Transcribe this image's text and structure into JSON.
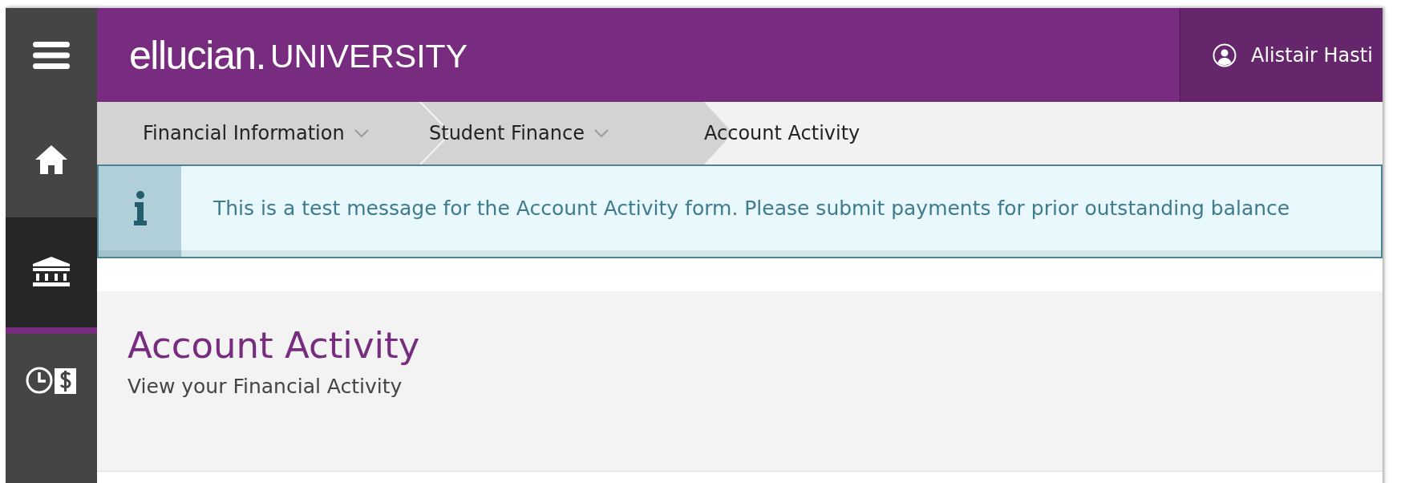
{
  "sidebar": {
    "items": [
      {
        "kind": "menu",
        "selected": false
      },
      {
        "kind": "home",
        "selected": false
      },
      {
        "kind": "bank",
        "selected": true
      },
      {
        "kind": "clock-dollar",
        "selected": false
      }
    ]
  },
  "header": {
    "logo_brand": "ellucian.",
    "logo_text": "UNIVERSITY",
    "user_name": "Alistair Hasti"
  },
  "breadcrumbs": [
    {
      "label": "Financial Information",
      "dropdown": true
    },
    {
      "label": "Student Finance",
      "dropdown": true
    },
    {
      "label": "Account Activity",
      "dropdown": false
    }
  ],
  "notification": {
    "message": "This is a test message for the Account Activity form. Please submit payments for prior outstanding balance"
  },
  "page": {
    "title": "Account Activity",
    "subtitle": "View your Financial Activity"
  }
}
